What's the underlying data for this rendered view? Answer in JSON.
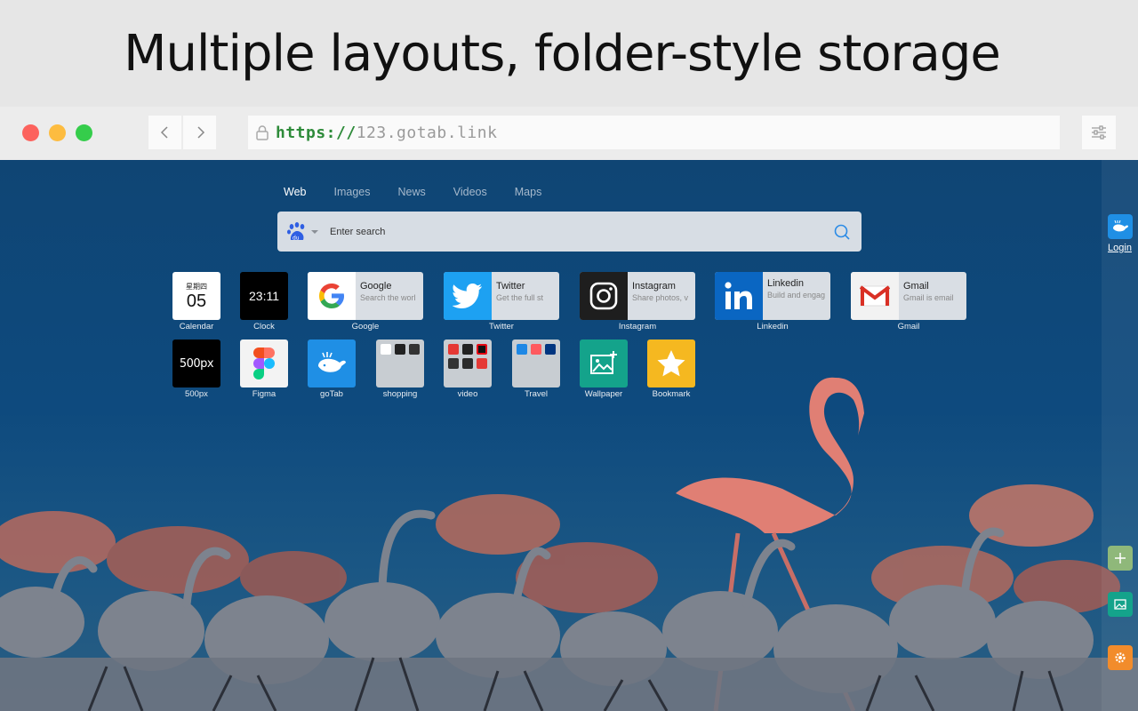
{
  "banner": {
    "title": "Multiple layouts, folder-style storage"
  },
  "browser": {
    "url_scheme": "https://",
    "url_host": "123.gotab.link"
  },
  "search": {
    "tabs": [
      "Web",
      "Images",
      "News",
      "Videos",
      "Maps"
    ],
    "active_tab": "Web",
    "placeholder": "Enter search",
    "engine": "baidu"
  },
  "tiles": {
    "calendar": {
      "weekday": "星期四",
      "day": "05",
      "label": "Calendar"
    },
    "clock": {
      "time": "23:11",
      "label": "Clock"
    },
    "google": {
      "title": "Google",
      "desc": "Search the worl",
      "label": "Google"
    },
    "twitter": {
      "title": "Twitter",
      "desc": "Get the full st",
      "label": "Twitter"
    },
    "instagram": {
      "title": "Instagram",
      "desc": "Share photos, v",
      "label": "Instagram"
    },
    "linkedin": {
      "title": "Linkedin",
      "desc": "Build and engag",
      "label": "Linkedin"
    },
    "gmail": {
      "title": "Gmail",
      "desc": "Gmail is email",
      "label": "Gmail"
    },
    "px500": {
      "logo": "500px",
      "label": "500px"
    },
    "figma": {
      "label": "Figma"
    },
    "gotab": {
      "label": "goTab"
    },
    "shopping": {
      "label": "shopping"
    },
    "video": {
      "label": "video"
    },
    "travel": {
      "label": "Travel"
    },
    "wallpaper": {
      "label": "Wallpaper"
    },
    "bookmark": {
      "label": "Bookmark"
    }
  },
  "sidebar": {
    "login": "Login"
  },
  "colors": {
    "accent_blue": "#1f8fe5",
    "add_green": "#8fb87a",
    "wallpaper_teal": "#14a38b",
    "settings_orange": "#f28c2b"
  }
}
